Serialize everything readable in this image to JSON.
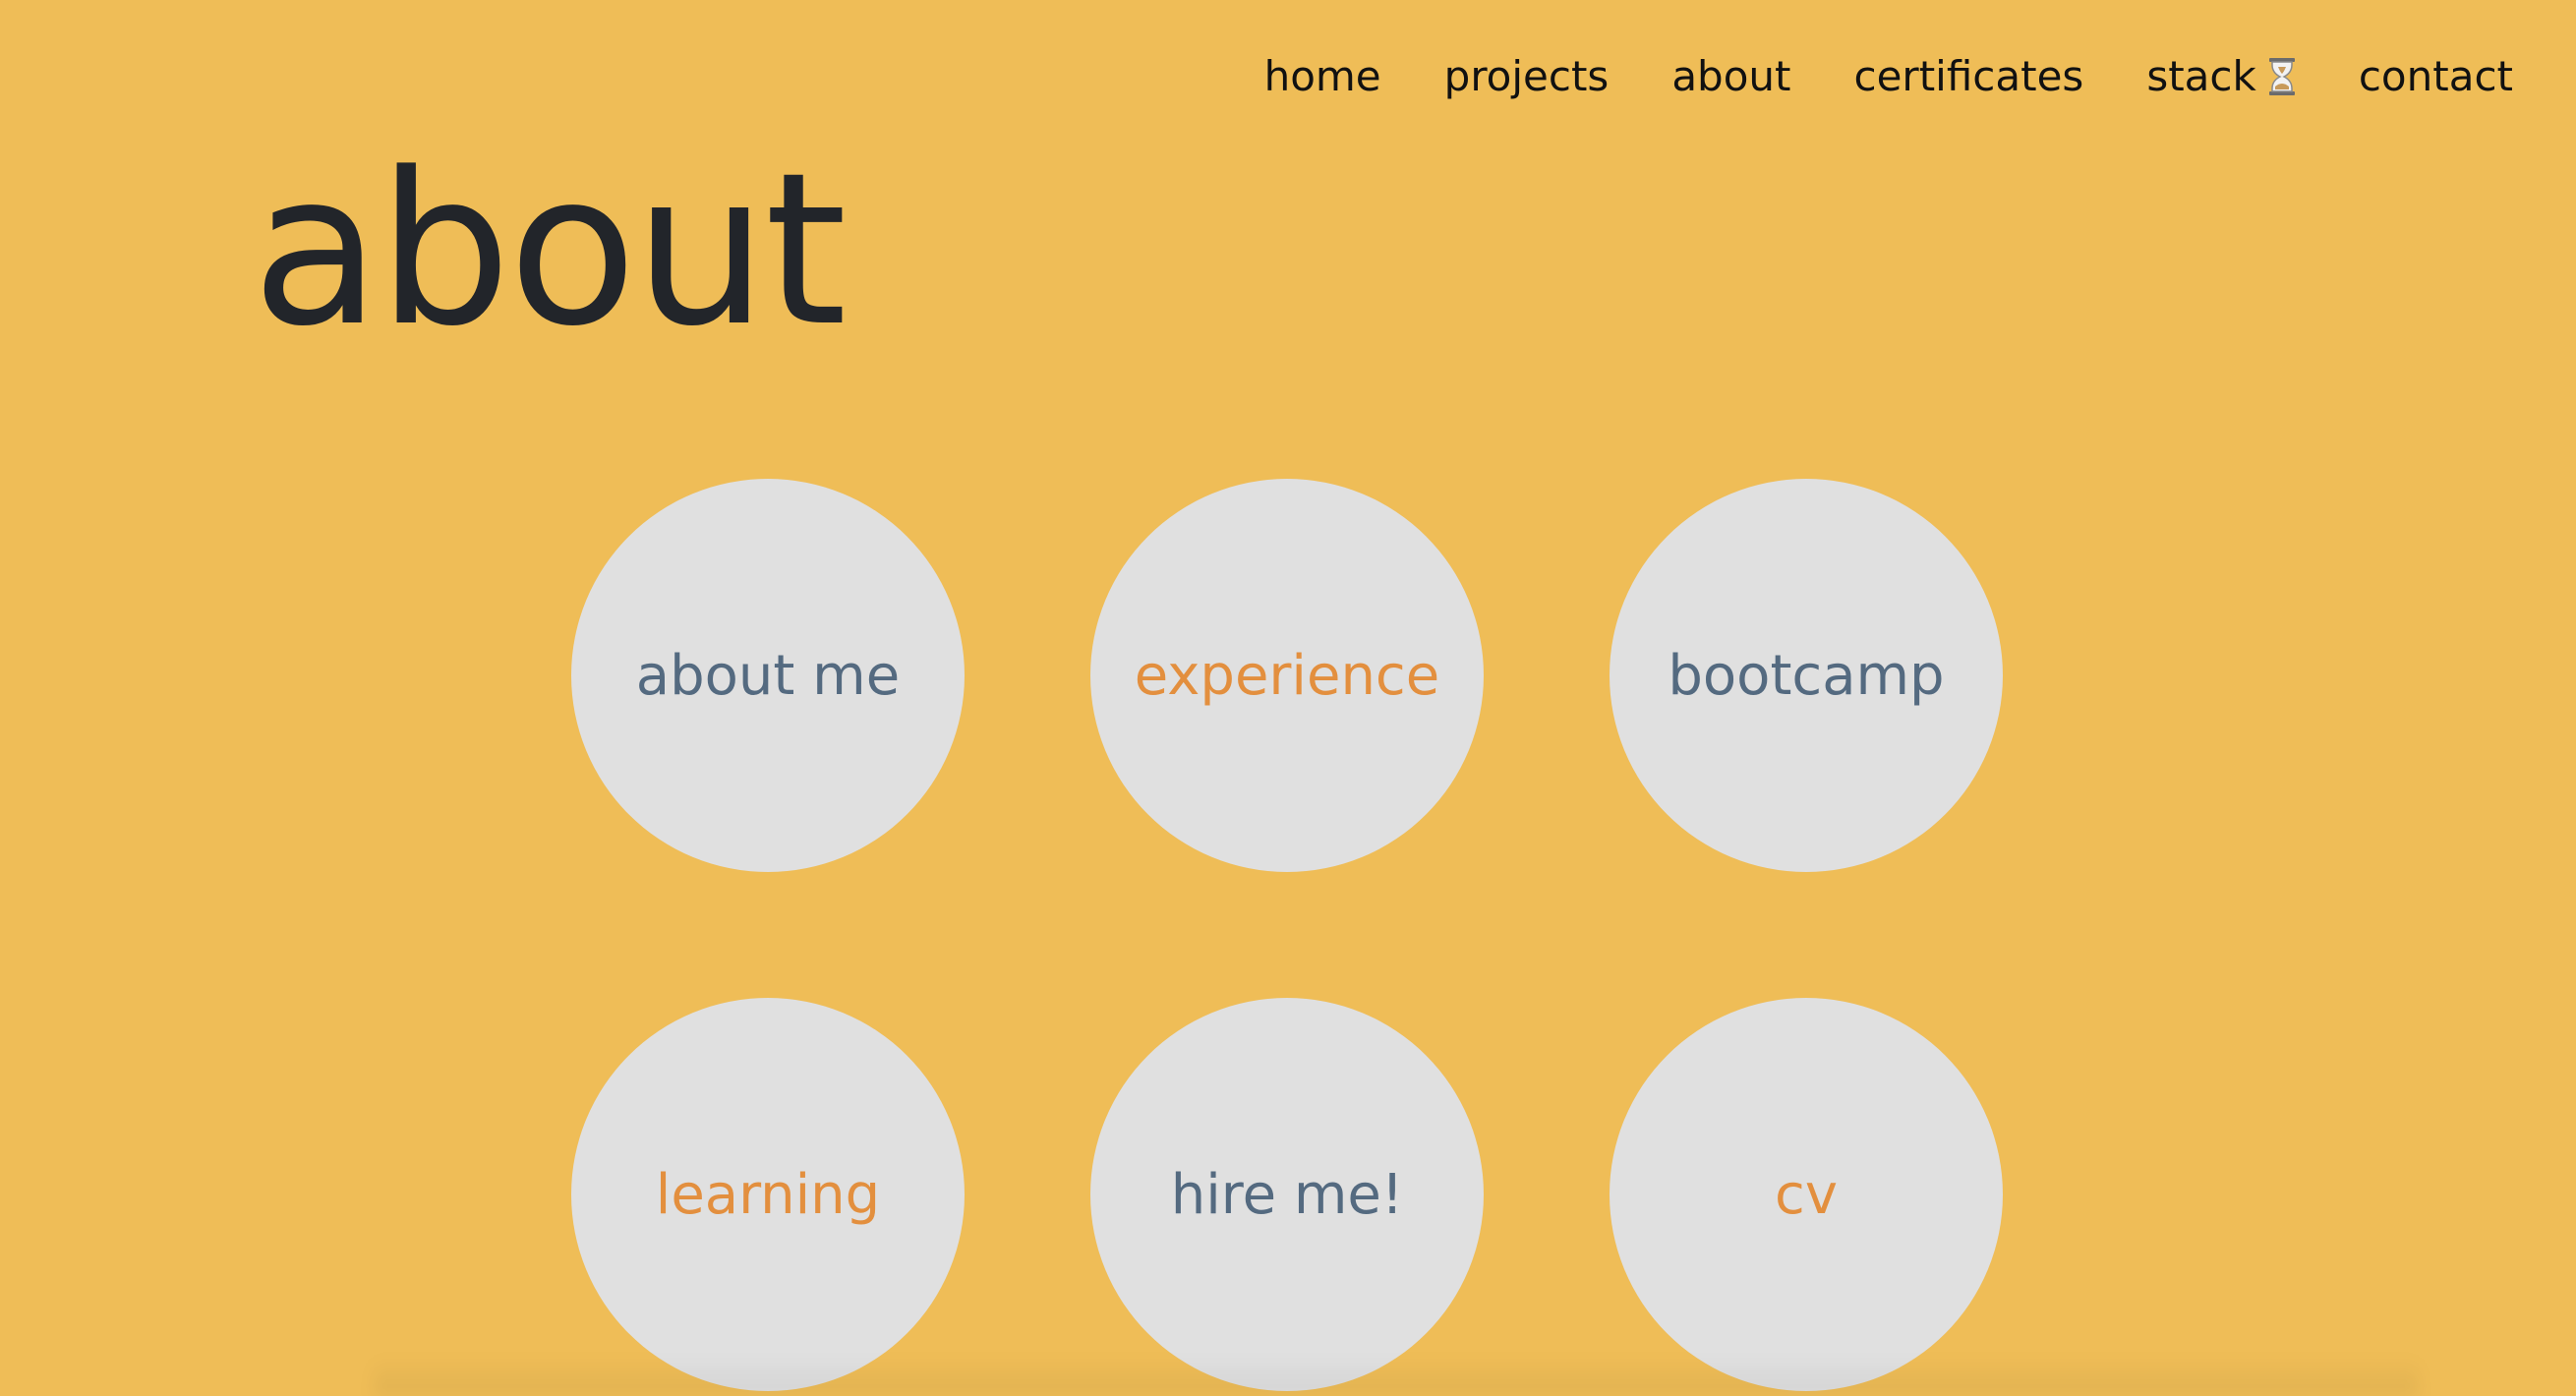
{
  "nav": {
    "items": [
      {
        "label": "home"
      },
      {
        "label": "projects"
      },
      {
        "label": "about"
      },
      {
        "label": "certificates"
      },
      {
        "label": "stack",
        "icon": "hourglass-icon"
      },
      {
        "label": "contact"
      }
    ]
  },
  "page": {
    "title": "about"
  },
  "circles": [
    {
      "label": "about me",
      "color": "#546A80"
    },
    {
      "label": "experience",
      "color": "#E38F3E"
    },
    {
      "label": "bootcamp",
      "color": "#546A80"
    },
    {
      "label": "learning",
      "color": "#E38F3E"
    },
    {
      "label": "hire me!",
      "color": "#546A80"
    },
    {
      "label": "cv",
      "color": "#E38F3E"
    }
  ],
  "colors": {
    "background": "#EFBD57",
    "circle": "#E0E0E0",
    "title": "#22252A",
    "slate": "#546A80",
    "orange": "#E38F3E"
  }
}
